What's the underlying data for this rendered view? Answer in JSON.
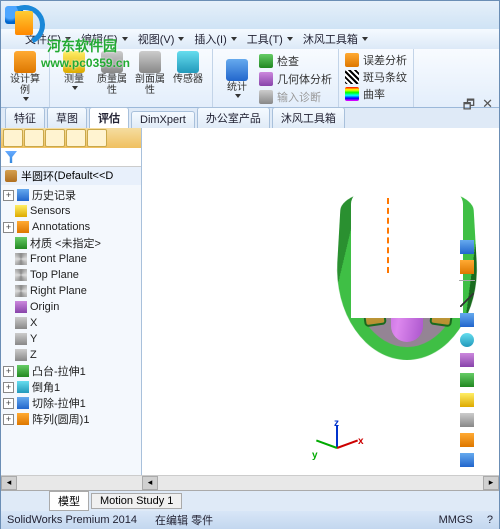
{
  "watermark": {
    "site": "河东软件园",
    "url": "www.pc0359.cn"
  },
  "menu": {
    "file": "文件(F)",
    "edit": "编辑(E)",
    "view": "视图(V)",
    "insert": "插入(I)",
    "tools": "工具(T)",
    "mofeng": "沐风工具箱"
  },
  "ribbon": {
    "group1_big": {
      "label": "设计算例"
    },
    "group2": [
      {
        "label": "测量"
      },
      {
        "label": "质量属性"
      },
      {
        "label": "剖面属性"
      },
      {
        "label": "传感器"
      }
    ],
    "group3": {
      "big": "统计",
      "items": [
        "检查",
        "几何体分析",
        "输入诊断"
      ]
    },
    "group4": {
      "items": [
        "误差分析",
        "斑马条纹",
        "曲率"
      ]
    }
  },
  "tabs": [
    "特征",
    "草图",
    "评估",
    "DimXpert",
    "办公室产品",
    "沐风工具箱"
  ],
  "tabs_active": 2,
  "part": {
    "name": "半圆环",
    "suffix": " (Default<<D"
  },
  "tree": [
    {
      "exp": "+",
      "icon": "i-blue",
      "label": "历史记录"
    },
    {
      "icon": "i-yellow",
      "label": "Sensors"
    },
    {
      "exp": "+",
      "icon": "i-orange",
      "label": "Annotations"
    },
    {
      "icon": "i-green",
      "label": "材质 <未指定>"
    },
    {
      "icon": "i-diamond",
      "label": "Front Plane"
    },
    {
      "icon": "i-diamond",
      "label": "Top Plane"
    },
    {
      "icon": "i-diamond",
      "label": "Right Plane"
    },
    {
      "icon": "i-purple",
      "label": "Origin"
    },
    {
      "icon": "i-gray",
      "label": "X"
    },
    {
      "icon": "i-gray",
      "label": "Y"
    },
    {
      "icon": "i-gray",
      "label": "Z"
    },
    {
      "exp": "+",
      "icon": "i-green",
      "label": "凸台-拉伸1"
    },
    {
      "exp": "+",
      "icon": "i-cyan",
      "label": "倒角1"
    },
    {
      "exp": "+",
      "icon": "i-blue",
      "label": "切除-拉伸1"
    },
    {
      "exp": "+",
      "icon": "i-orange",
      "label": "阵列(圆周)1"
    }
  ],
  "triad": {
    "x": "x",
    "y": "y",
    "z": "z"
  },
  "viewtabs": {
    "model": "模型",
    "motion": "Motion Study 1"
  },
  "status": {
    "product": "SolidWorks Premium 2014",
    "state": "在编辑 零件",
    "units": "MMGS",
    "count": "?"
  }
}
